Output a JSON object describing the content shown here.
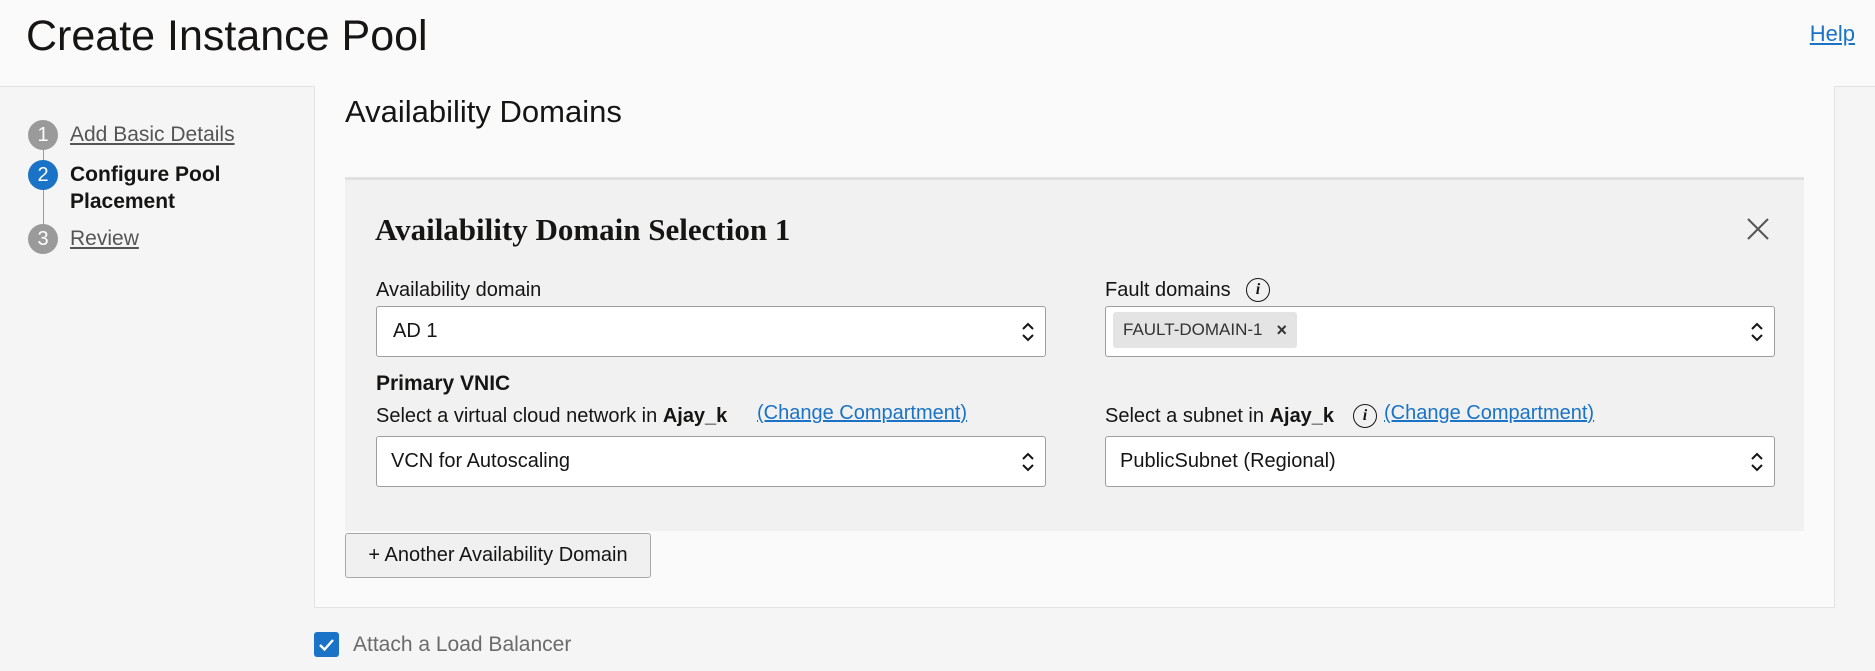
{
  "header": {
    "title": "Create Instance Pool",
    "help_label": "Help"
  },
  "steps": [
    {
      "number": "1",
      "label": "Add Basic Details",
      "state": "link"
    },
    {
      "number": "2",
      "label": "Configure Pool Placement",
      "state": "active"
    },
    {
      "number": "3",
      "label": "Review",
      "state": "link"
    }
  ],
  "section": {
    "title": "Availability Domains",
    "card_title": "Availability Domain Selection 1",
    "availability_domain": {
      "label": "Availability domain",
      "value": "AD 1"
    },
    "fault_domains": {
      "label": "Fault domains",
      "chips": [
        "FAULT-DOMAIN-1"
      ]
    },
    "primary_vnic": {
      "heading": "Primary VNIC",
      "vcn_label_prefix": "Select a virtual cloud network in",
      "vcn_compartment": "Ajay_k",
      "vcn_change_label": "(Change Compartment)",
      "vcn_value": "VCN for Autoscaling",
      "subnet_label_prefix": "Select a subnet in",
      "subnet_compartment": "Ajay_k",
      "subnet_change_label": "(Change Compartment)",
      "subnet_value": "PublicSubnet (Regional)"
    },
    "add_domain_label": "+ Another Availability Domain"
  },
  "load_balancer": {
    "label": "Attach a Load Balancer",
    "checked": true
  },
  "colors": {
    "accent": "#1a73c6",
    "step_inactive": "#9a9a9a",
    "text": "#161513"
  }
}
